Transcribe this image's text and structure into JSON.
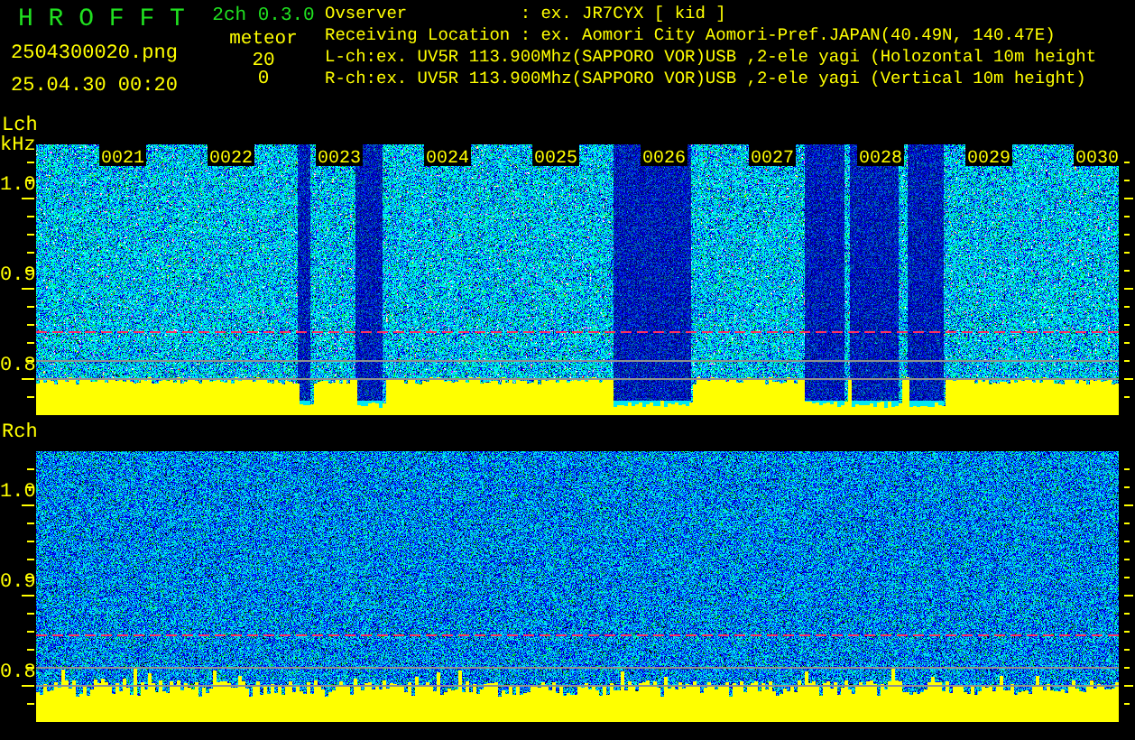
{
  "header": {
    "title": "H R O F F T",
    "file_name": "2504300020.png",
    "timestamp": "25.04.30 00:20",
    "version": "2ch 0.3.0"
  },
  "meteor": {
    "label": "meteor",
    "counts": [
      "20",
      "0"
    ]
  },
  "info_lines": [
    "Ovserver           : ex. JR7CYX [ kid ]",
    "Receiving Location : ex. Aomori City Aomori-Pref.JAPAN(40.49N, 140.47E)",
    "L-ch:ex. UV5R 113.900Mhz(SAPPORO VOR)USB ,2-ele yagi (Holozontal 10m height",
    "R-ch:ex. UV5R 113.900Mhz(SAPPORO VOR)USB ,2-ele yagi (Vertical 10m height)"
  ],
  "panels": [
    {
      "channel": "Lch",
      "unit": "kHz",
      "y_labels": [
        "1.0",
        "0.9",
        "0.8"
      ],
      "time_labels": [
        "0021",
        "0022",
        "0023",
        "0024",
        "0025",
        "0026",
        "0027",
        "0028",
        "0029",
        "0030"
      ]
    },
    {
      "channel": "Rch",
      "y_labels": [
        "1.0",
        "0.9",
        "0.8"
      ]
    }
  ]
}
